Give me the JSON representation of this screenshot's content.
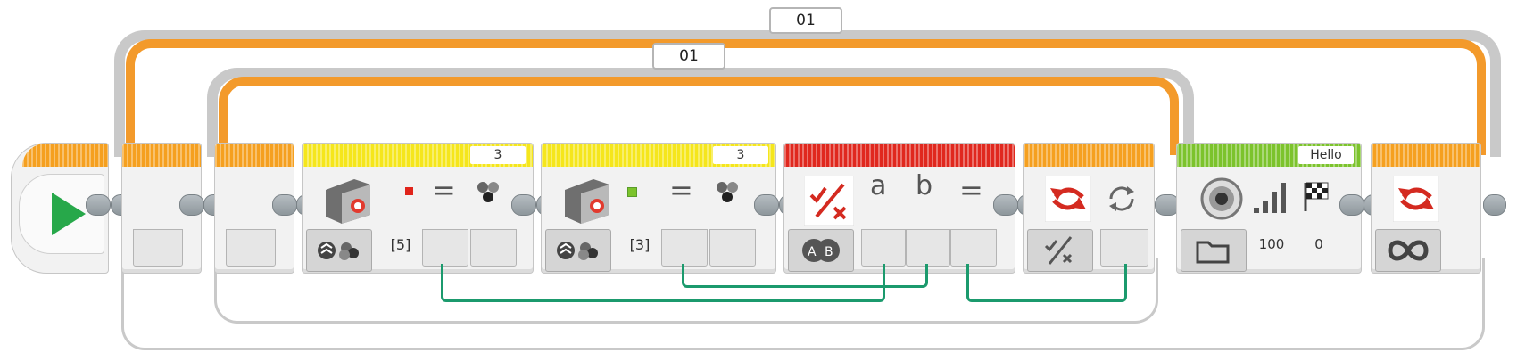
{
  "outer_loop": {
    "name": "01",
    "mode_icon": "infinity-icon"
  },
  "inner_loop": {
    "name": "01"
  },
  "program_start": {
    "icon": "play-icon"
  },
  "blocks": [
    {
      "id": "sensor1",
      "type": "color-sensor-compare",
      "port": "3",
      "colors": "[5]",
      "indicator_color": "#e0241b"
    },
    {
      "id": "sensor2",
      "type": "color-sensor-compare",
      "port": "3",
      "colors": "[3]",
      "indicator_color": "#7cc32c"
    },
    {
      "id": "logic",
      "type": "logic-operations",
      "mode_icon": "and-icon",
      "inputs": [
        "a",
        "b"
      ],
      "result": "="
    },
    {
      "id": "loop-interrupt",
      "type": "loop-interrupt-by-condition",
      "icon": "loop-interrupt-icon"
    },
    {
      "id": "sound",
      "type": "sound",
      "header_value": "Hello",
      "volume": "100",
      "play_type": "0"
    }
  ],
  "colors": {
    "orange": "#f5a020",
    "yellow": "#f5e61c",
    "red": "#e0281e",
    "green": "#7cc32c",
    "wire": "#1b9a6d"
  }
}
